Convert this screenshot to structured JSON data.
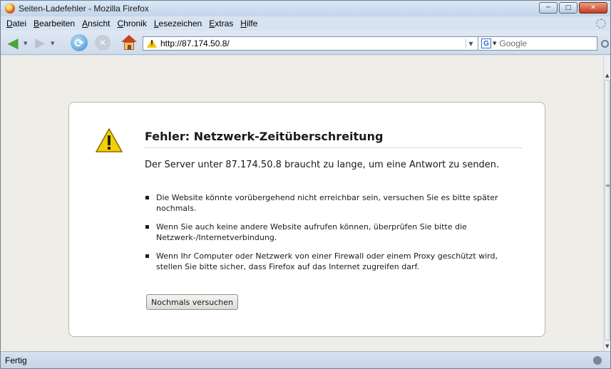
{
  "window": {
    "title": "Seiten-Ladefehler - Mozilla Firefox"
  },
  "menu": {
    "items": [
      {
        "label": "Datei",
        "underline": "D",
        "rest": "atei"
      },
      {
        "label": "Bearbeiten",
        "underline": "B",
        "rest": "earbeiten"
      },
      {
        "label": "Ansicht",
        "underline": "A",
        "rest": "nsicht"
      },
      {
        "label": "Chronik",
        "underline": "C",
        "rest": "hronik"
      },
      {
        "label": "Lesezeichen",
        "underline": "L",
        "rest": "esezeichen"
      },
      {
        "label": "Extras",
        "underline": "E",
        "rest": "xtras"
      },
      {
        "label": "Hilfe",
        "underline": "H",
        "rest": "ilfe"
      }
    ]
  },
  "toolbar": {
    "url": "http://87.174.50.8/",
    "search_placeholder": "Google"
  },
  "error": {
    "title": "Fehler: Netzwerk-Zeitüberschreitung",
    "description": "Der Server unter 87.174.50.8 braucht zu lange, um eine Antwort zu senden.",
    "items": [
      "Die Website könnte vorübergehend nicht erreichbar sein, versuchen Sie es bitte später nochmals.",
      "Wenn Sie auch keine andere Website aufrufen können, überprüfen Sie bitte die Netzwerk-/Internetverbindung.",
      "Wenn Ihr Computer oder Netzwerk von einer Firewall oder einem Proxy geschützt wird, stellen Sie bitte sicher, dass Firefox auf das Internet zugreifen darf."
    ],
    "retry_label": "Nochmals versuchen"
  },
  "status": {
    "text": "Fertig"
  },
  "icons": {
    "back": "back-arrow-icon",
    "forward": "forward-arrow-icon",
    "reload": "reload-icon",
    "stop": "stop-icon",
    "home": "home-icon",
    "warning": "warning-icon",
    "go": "go-arrow-icon",
    "search_engine": "google-icon",
    "search": "magnifier-icon"
  },
  "colors": {
    "window_chrome": "#d9e4f1",
    "content_bg": "#eeede7",
    "warning": "#f2c511",
    "go_green": "#3fa92c"
  }
}
